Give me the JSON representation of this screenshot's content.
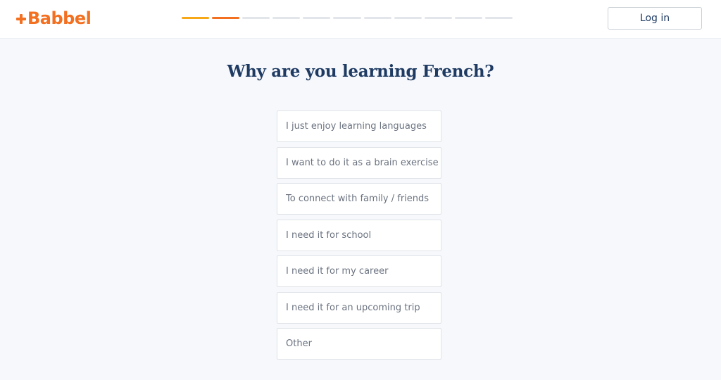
{
  "header": {
    "logo_text": "Babbel",
    "login_label": "Log in",
    "progress": {
      "total_steps": 11,
      "completed_steps": 2,
      "colors": [
        "#f7a817",
        "#f37021"
      ],
      "inactive_color": "#e2e6ea"
    }
  },
  "question": {
    "title": "Why are you learning French?"
  },
  "options": [
    {
      "label": "I just enjoy learning languages"
    },
    {
      "label": "I want to do it as a brain exercise"
    },
    {
      "label": "To connect with family / friends"
    },
    {
      "label": "I need it for school"
    },
    {
      "label": "I need it for my career"
    },
    {
      "label": "I need it for an upcoming trip"
    },
    {
      "label": "Other"
    }
  ],
  "colors": {
    "brand": "#f37021",
    "title": "#1f3b63",
    "option_text": "#6b7380",
    "background": "#f6f8fb"
  }
}
